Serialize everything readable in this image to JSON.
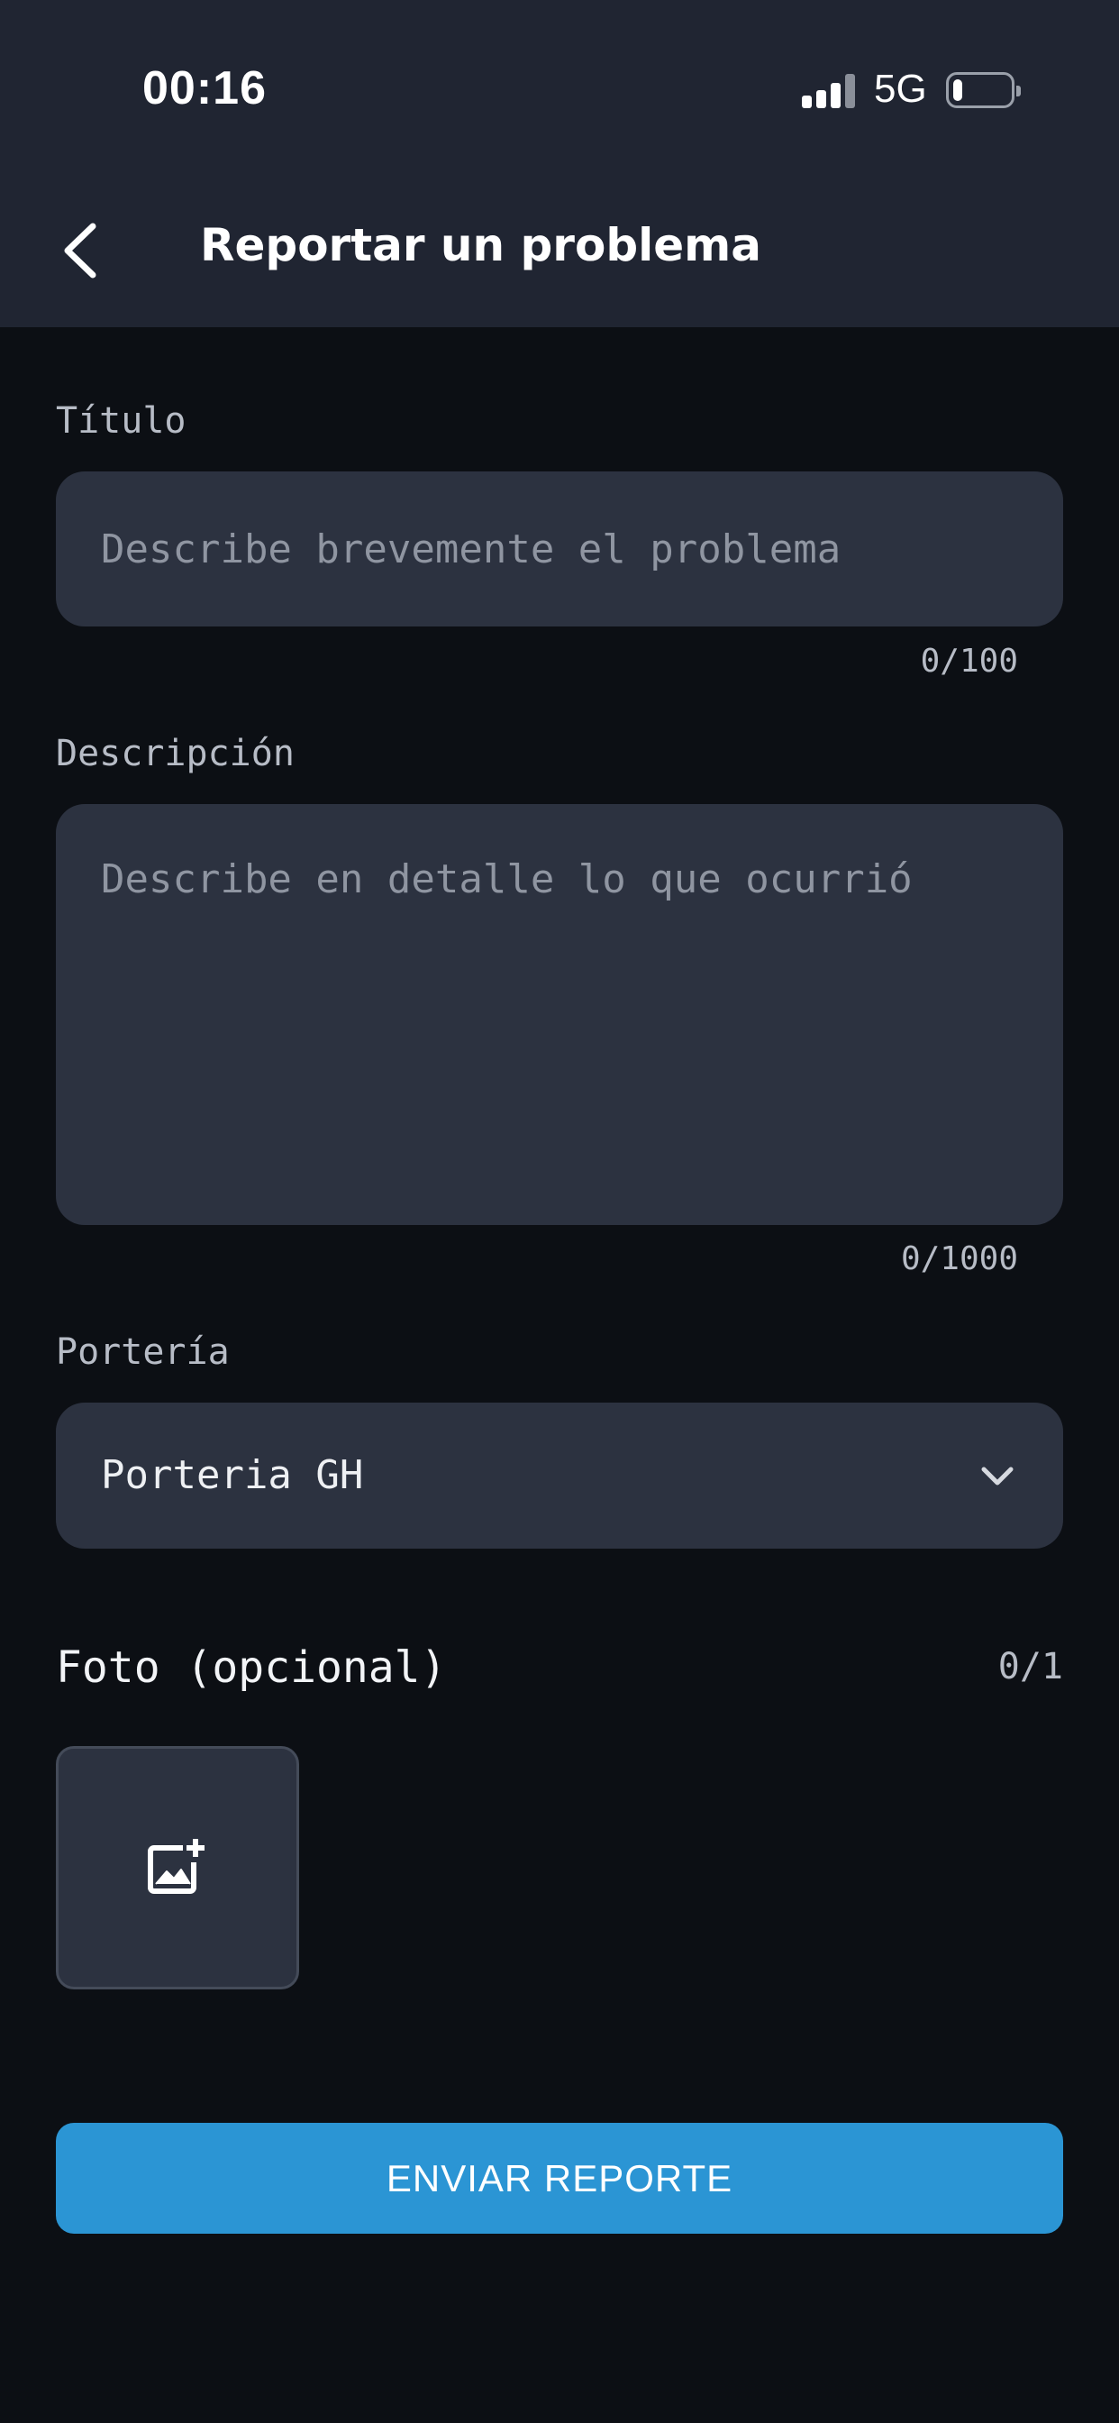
{
  "status_bar": {
    "time": "00:16",
    "network": "5G",
    "battery_level": 0.15,
    "signal_bars_active": 3
  },
  "header": {
    "back_icon": "chevron-left-icon",
    "title": "Reportar un problema"
  },
  "form": {
    "title_field": {
      "label": "Título",
      "placeholder": "Describe brevemente el problema",
      "value": "",
      "counter": "0/100"
    },
    "description_field": {
      "label": "Descripción",
      "placeholder": "Describe en detalle lo que ocurrió",
      "value": "",
      "counter": "0/1000"
    },
    "porteria_field": {
      "label": "Portería",
      "selected": "Porteria GH",
      "icon": "chevron-down-icon"
    },
    "photo": {
      "label": "Foto (opcional)",
      "count": "0/1",
      "icon": "add-photo-icon"
    },
    "submit_label": "ENVIAR REPORTE"
  },
  "colors": {
    "background": "#0c0f14",
    "header": "#202532",
    "field": "#2c3240",
    "accent": "#2b95d4"
  }
}
